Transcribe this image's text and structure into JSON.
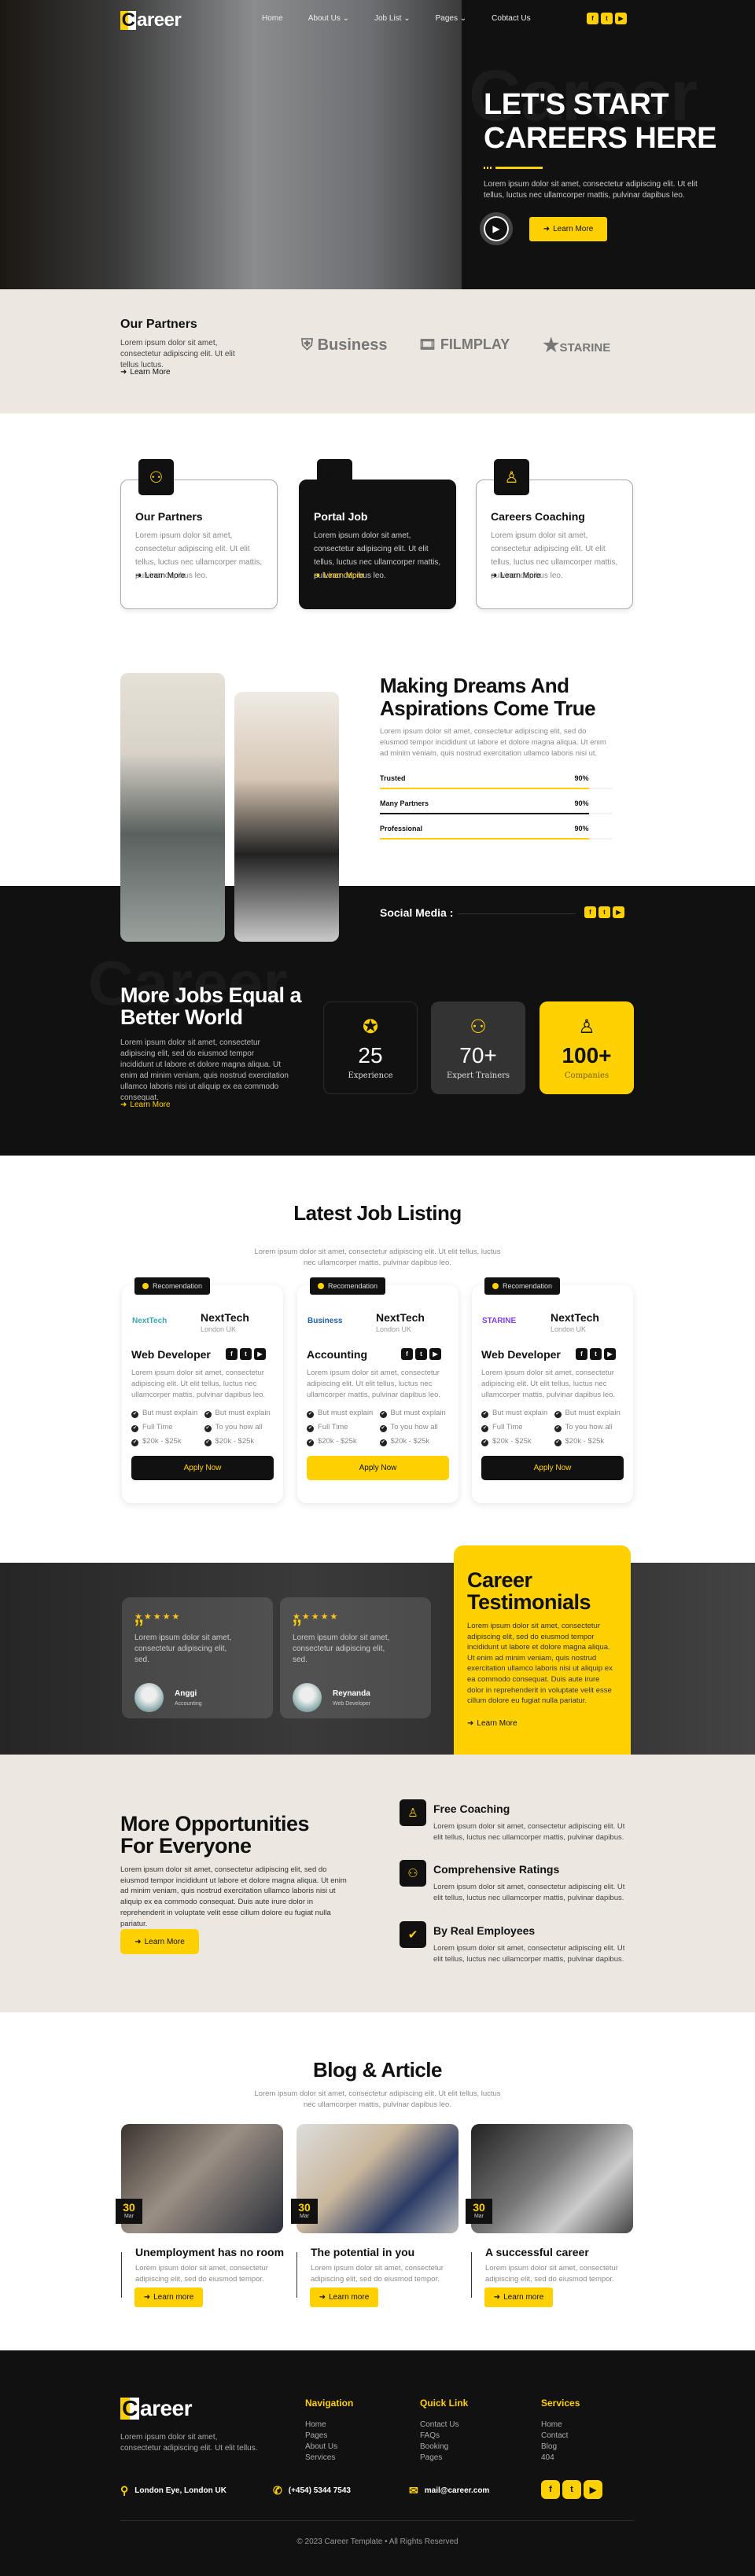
{
  "brand": {
    "logo_letter": "C",
    "logo_rest": "areer"
  },
  "nav": {
    "items": [
      {
        "label": "Home",
        "dropdown": false
      },
      {
        "label": "About Us",
        "dropdown": true
      },
      {
        "label": "Job List",
        "dropdown": true
      },
      {
        "label": "Pages",
        "dropdown": true
      },
      {
        "label": "Cobtact Us",
        "dropdown": false
      }
    ],
    "social": [
      "facebook-icon",
      "twitter-icon",
      "youtube-icon"
    ]
  },
  "hero": {
    "watermark": "Career",
    "title_line1": "LET'S START",
    "title_line2": "CAREERS HERE",
    "text": "Lorem ipsum dolor sit amet, consectetur adipiscing elit. Ut elit tellus, luctus nec ullamcorper mattis, pulvinar dapibus leo.",
    "button": "Learn More"
  },
  "partners": {
    "title": "Our Partners",
    "text": "Lorem ipsum dolor sit amet, consectetur adipiscing elit. Ut elit tellus luctus.",
    "link": "Learn More",
    "logos": [
      "Business",
      "FILMPLAY",
      "STARINE"
    ]
  },
  "services": [
    {
      "title": "Our Partners",
      "text": "Lorem ipsum dolor sit amet, consectetur adipiscing elit. Ut elit tellus, luctus nec ullamcorper mattis, pulvinar dapibus leo.",
      "link": "Learn More",
      "icon": "team-icon"
    },
    {
      "title": "Portal Job",
      "text": "Lorem ipsum dolor sit amet, consectetur adipiscing elit. Ut elit tellus, luctus nec ullamcorper mattis, pulvinar dapibus leo.",
      "link": "Learn More",
      "icon": "document-pen-icon"
    },
    {
      "title": "Careers Coaching",
      "text": "Lorem ipsum dolor sit amet, consectetur adipiscing elit. Ut elit tellus, luctus nec ullamcorper mattis, pulvinar dapibus leo.",
      "link": "Learn More",
      "icon": "person-icon"
    }
  ],
  "about": {
    "title_line1": "Making Dreams And",
    "title_line2": "Aspirations Come True",
    "text": "Lorem ipsum dolor sit amet, consectetur adipiscing elit, sed do eiusmod tempor incididunt ut labore et dolore magna aliqua. Ut enim ad minim veniam, quis nostrud exercitation ullamco laboris nisi ut.",
    "bars": [
      {
        "label": "Trusted",
        "value": "90%",
        "percent": 90,
        "color": "#ffd100"
      },
      {
        "label": "Many Partners",
        "value": "90%",
        "percent": 90,
        "color": "#111111"
      },
      {
        "label": "Professional",
        "value": "90%",
        "percent": 90,
        "color": "#ffd100"
      }
    ],
    "social_label": "Social Media :"
  },
  "jobs_world": {
    "watermark": "Career",
    "title_line1": "More Jobs Equal a",
    "title_line2": "Better World",
    "text": "Lorem ipsum dolor sit amet, consectetur adipiscing elit, sed do eiusmod tempor incididunt ut labore et dolore magna aliqua. Ut enim ad minim veniam, quis nostrud exercitation ullamco laboris nisi ut aliquip ex ea commodo consequat.",
    "link": "Learn More",
    "stats": [
      {
        "value": "25",
        "label": "Experience",
        "icon": "award-thumb-icon"
      },
      {
        "value": "70+",
        "label": "Expert Trainers",
        "icon": "team-icon"
      },
      {
        "value": "100+",
        "label": "Companies",
        "icon": "employee-icon"
      }
    ]
  },
  "listing": {
    "title": "Latest Job Listing",
    "subtitle_line1": "Lorem ipsum dolor sit amet, consectetur adipiscing elit. Ut elit tellus, luctus",
    "subtitle_line2": "nec ullamcorper mattis, pulvinar dapibus leo.",
    "jobs": [
      {
        "badge": "Recomendation",
        "logo": "NextTech",
        "company": "NextTech",
        "location": "London UK",
        "title": "Web Developer",
        "text": "Lorem ipsum dolor sit amet, consectetur adipiscing elit. Ut elit tellus, luctus nec ullamcorper mattis, pulvinar dapibus leo.",
        "bullets": [
          "But must explain",
          "But must explain",
          "Full Time",
          "To you how all",
          "$20k - $25k",
          "$20k - $25k"
        ],
        "button": "Apply Now"
      },
      {
        "badge": "Recomendation",
        "logo": "Business",
        "company": "NextTech",
        "location": "London UK",
        "title": "Accounting",
        "text": "Lorem ipsum dolor sit amet, consectetur adipiscing elit. Ut elit tellus, luctus nec ullamcorper mattis, pulvinar dapibus leo.",
        "bullets": [
          "But must explain",
          "But must explain",
          "Full Time",
          "To you how all",
          "$20k - $25k",
          "$20k - $25k"
        ],
        "button": "Apply Now"
      },
      {
        "badge": "Recomendation",
        "logo": "STARINE",
        "company": "NextTech",
        "location": "London UK",
        "title": "Web Developer",
        "text": "Lorem ipsum dolor sit amet, consectetur adipiscing elit. Ut elit tellus, luctus nec ullamcorper mattis, pulvinar dapibus leo.",
        "bullets": [
          "But must explain",
          "But must explain",
          "Full Time",
          "To you how all",
          "$20k - $25k",
          "$20k - $25k"
        ],
        "button": "Apply Now"
      }
    ]
  },
  "testimonials": {
    "title_line1": "Career",
    "title_line2": "Testimonials",
    "text": "Lorem ipsum dolor sit amet, consectetur adipiscing elit, sed do eiusmod tempor incididunt ut labore et dolore magna aliqua. Ut enim ad minim veniam, quis nostrud exercitation ullamco laboris nisi ut aliquip ex ea commodo consequat. Duis aute irure dolor in reprehenderit in voluptate velit esse cillum dolore eu fugiat nulla pariatur.",
    "link": "Learn More",
    "items": [
      {
        "rating": 5,
        "quote": "Lorem ipsum dolor sit amet, consectetur adipiscing elit, sed.",
        "name": "Anggi",
        "role": "Accounting"
      },
      {
        "rating": 5,
        "quote": "Lorem ipsum dolor sit amet, consectetur adipiscing elit, sed.",
        "name": "Reynanda",
        "role": "Web Developer"
      }
    ]
  },
  "opportunities": {
    "title_line1": "More Opportunities",
    "title_line2": "For Everyone",
    "text": "Lorem ipsum dolor sit amet, consectetur adipiscing elit, sed do eiusmod tempor incididunt ut labore et dolore magna aliqua. Ut enim ad minim veniam, quis nostrud exercitation ullamco laboris nisi ut aliquip ex ea commodo consequat. Duis aute irure dolor in reprehenderit in voluptate velit esse cillum dolore eu fugiat nulla pariatur.",
    "button": "Learn More",
    "features": [
      {
        "title": "Free Coaching",
        "text": "Lorem ipsum dolor sit amet, consectetur adipiscing elit. Ut elit tellus, luctus nec ullamcorper mattis, pulvinar dapibus.",
        "icon": "coach-icon"
      },
      {
        "title": "Comprehensive Ratings",
        "text": "Lorem ipsum dolor sit amet, consectetur adipiscing elit. Ut elit tellus, luctus nec ullamcorper mattis, pulvinar dapibus.",
        "icon": "hierarchy-icon"
      },
      {
        "title": "By Real Employees",
        "text": "Lorem ipsum dolor sit amet, consectetur adipiscing elit. Ut elit tellus, luctus nec ullamcorper mattis, pulvinar dapibus.",
        "icon": "check-badge-icon"
      }
    ]
  },
  "blog": {
    "title": "Blog & Article",
    "subtitle_line1": "Lorem ipsum dolor sit amet, consectetur adipiscing elit. Ut elit tellus, luctus",
    "subtitle_line2": "nec ullamcorper mattis, pulvinar dapibus leo.",
    "posts": [
      {
        "day": "30",
        "month": "Mar",
        "title": "Unemployment has no room",
        "text": "Lorem ipsum dolor sit amet, consectetur adipiscing elit, sed do eiusmod tempor.",
        "button": "Learn more"
      },
      {
        "day": "30",
        "month": "Mar",
        "title": "The potential in you",
        "text": "Lorem ipsum dolor sit amet, consectetur adipiscing elit, sed do eiusmod tempor.",
        "button": "Learn more"
      },
      {
        "day": "30",
        "month": "Mar",
        "title": "A successful career",
        "text": "Lorem ipsum dolor sit amet, consectetur adipiscing elit, sed do eiusmod tempor.",
        "button": "Learn more"
      }
    ]
  },
  "footer": {
    "text": "Lorem ipsum dolor sit amet, consectetur adipiscing elit. Ut elit tellus.",
    "columns": [
      {
        "title": "Navigation",
        "links": [
          "Home",
          "Pages",
          "About Us",
          "Services"
        ]
      },
      {
        "title": "Quick Link",
        "links": [
          "Contact Us",
          "FAQs",
          "Booking",
          "Pages"
        ]
      },
      {
        "title": "Services",
        "links": [
          "Home",
          "Contact",
          "Blog",
          "404"
        ]
      }
    ],
    "address": "London Eye, London UK",
    "phone": "(+454) 5344 7543",
    "email": "mail@career.com",
    "copyright": "© 2023 Career Template • All Rights Reserved"
  },
  "colors": {
    "accent": "#ffd100",
    "dark": "#111111",
    "beige": "#ece8e1"
  }
}
